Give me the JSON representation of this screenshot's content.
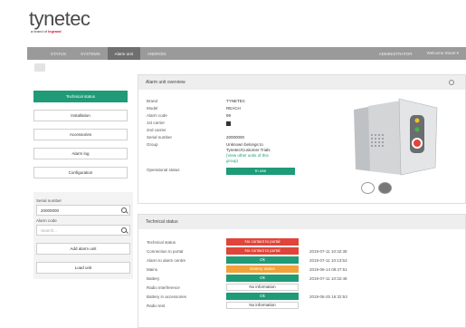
{
  "logo": {
    "word": "tynetec",
    "sub_prefix": "a brand of ",
    "sub_brand": "legrand"
  },
  "nav": {
    "items": [
      "STATUS",
      "SYSTEMS",
      "Alarm unit",
      "ANDROID"
    ],
    "active_index": 2,
    "right_items": [
      "ADMINISTRATOR",
      "Welcome Stuart ▾"
    ]
  },
  "sidebar": {
    "buttons": [
      "Technical status",
      "Installation",
      "Accessories",
      "Alarm log",
      "Configuration"
    ],
    "active_index": 0,
    "serial_label": "Serial number",
    "serial_value": "20000000",
    "alarm_label": "Alarm code",
    "alarm_placeholder": "Search...",
    "add_button": "Add alarm unit",
    "load_button": "Load unit"
  },
  "overview": {
    "title": "Alarm unit overview",
    "rows": [
      {
        "label": "Brand",
        "value": "TYNETEC"
      },
      {
        "label": "Model",
        "value": "REACH"
      },
      {
        "label": "Alarm code",
        "value": "99"
      },
      {
        "label": "1st carrier",
        "value": ""
      },
      {
        "label": "2nd carrier",
        "value": ""
      },
      {
        "label": "Serial number",
        "value": "20000000"
      }
    ],
    "group_label": "Group",
    "group_value": "Unknown belongs to",
    "group_value2": "Tynetec/Customer Trials",
    "group_link1": "(View other units of this",
    "group_link2": "group)",
    "op_label": "Operational status",
    "op_value": "In use",
    "colors": {
      "accent": "#1f9b78",
      "red": "#e0443a",
      "orange": "#f2a23a"
    }
  },
  "technical": {
    "title": "Technical status",
    "rows": [
      {
        "label": "Technical status",
        "status": "No contact to portal",
        "state": "red",
        "time": ""
      },
      {
        "label": "Connection to portal",
        "status": "No contact to portal",
        "state": "red",
        "time": "2019-07-11 10:32:38"
      },
      {
        "label": "Alarm to alarm centre",
        "status": "Ok",
        "state": "green",
        "time": "2019-07-11 10:13:53"
      },
      {
        "label": "Mains",
        "status": "Battery status",
        "state": "orange",
        "time": "2019-06-14 08:47:51"
      },
      {
        "label": "Battery",
        "status": "Ok",
        "state": "green",
        "time": "2019-07-11 10:32:48"
      },
      {
        "label": "Radio interference",
        "status": "No information",
        "state": "none",
        "time": ""
      },
      {
        "label": "Battery in accessories",
        "status": "Ok",
        "state": "green",
        "time": "2019-06-25 16:32:53"
      },
      {
        "label": "Radio test",
        "status": "No information",
        "state": "none",
        "time": ""
      }
    ]
  }
}
